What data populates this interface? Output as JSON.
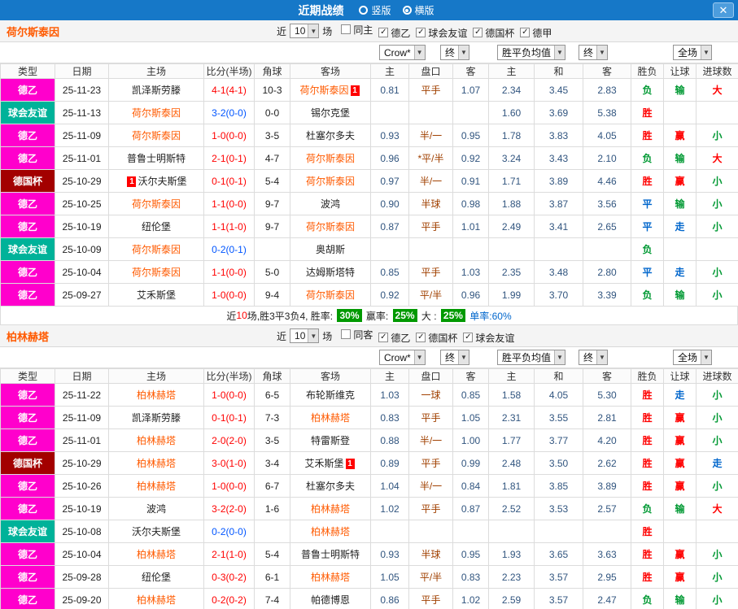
{
  "titlebar": {
    "title": "近期战绩",
    "layout_options": [
      {
        "label": "竖版",
        "selected": false
      },
      {
        "label": "横版",
        "selected": true
      }
    ],
    "close_glyph": "✕"
  },
  "columns": [
    "类型",
    "日期",
    "主场",
    "比分(半场)",
    "角球",
    "客场",
    "主",
    "盘口",
    "客",
    "主",
    "和",
    "客",
    "胜负",
    "让球",
    "进球数"
  ],
  "colors": {
    "titlebar_bg": "#1678c8",
    "team_focus": "#ff5a00",
    "score_red": "#ff0000",
    "score_blue": "#0055ff",
    "rate_badge_bg": "#009900",
    "type_colors": {
      "德乙": "#ff00cc",
      "球会友谊": "#00b299",
      "德国杯": "#a30000"
    },
    "outcome_colors": {
      "胜": "#ff0000",
      "平": "#0066cc",
      "负": "#009933",
      "赢": "#ff0000",
      "走": "#0066cc",
      "输": "#009933",
      "大": "#ff0000",
      "小": "#009933"
    }
  },
  "sections": [
    {
      "team": "荷尔斯泰因",
      "filter": {
        "near_label": "近",
        "count": "10",
        "games_label": "场",
        "checkboxes": [
          {
            "label": "同主",
            "checked": false
          },
          {
            "label": "德乙",
            "checked": true
          },
          {
            "label": "球会友谊",
            "checked": true
          },
          {
            "label": "德国杯",
            "checked": true
          },
          {
            "label": "德甲",
            "checked": true
          }
        ]
      },
      "dropdowns": {
        "company": "Crow*",
        "company_time": "终",
        "europe": "胜平负均值",
        "europe_time": "终",
        "scope": "全场"
      },
      "rows": [
        {
          "type": "德乙",
          "date": "25-11-23",
          "home": "凯泽斯劳滕",
          "score": "4-1(4-1)",
          "corner": "10-3",
          "away": "荷尔斯泰因",
          "ab": "1",
          "o1": "0.81",
          "o2": "平手",
          "o3": "1.07",
          "e1": "2.34",
          "e2": "3.45",
          "e3": "2.83",
          "r1": "负",
          "r2": "输",
          "r3": "大"
        },
        {
          "type": "球会友谊",
          "date": "25-11-13",
          "home": "荷尔斯泰因",
          "score": "3-2(0-0)",
          "score_blue": true,
          "corner": "0-0",
          "away": "锡尔克堡",
          "e1": "1.60",
          "e2": "3.69",
          "e3": "5.38",
          "r1": "胜"
        },
        {
          "type": "德乙",
          "date": "25-11-09",
          "home": "荷尔斯泰因",
          "score": "1-0(0-0)",
          "corner": "3-5",
          "away": "杜塞尔多夫",
          "o1": "0.93",
          "o2": "半/一",
          "o3": "0.95",
          "e1": "1.78",
          "e2": "3.83",
          "e3": "4.05",
          "r1": "胜",
          "r2": "赢",
          "r3": "小"
        },
        {
          "type": "德乙",
          "date": "25-11-01",
          "home": "普鲁士明斯特",
          "score": "2-1(0-1)",
          "corner": "4-7",
          "away": "荷尔斯泰因",
          "o1": "0.96",
          "o2": "*平/半",
          "o3": "0.92",
          "e1": "3.24",
          "e2": "3.43",
          "e3": "2.10",
          "r1": "负",
          "r2": "输",
          "r3": "大"
        },
        {
          "type": "德国杯",
          "date": "25-10-29",
          "home": "沃尔夫斯堡",
          "hb_pre": "1",
          "score": "0-1(0-1)",
          "corner": "5-4",
          "away": "荷尔斯泰因",
          "o1": "0.97",
          "o2": "半/一",
          "o3": "0.91",
          "e1": "1.71",
          "e2": "3.89",
          "e3": "4.46",
          "r1": "胜",
          "r2": "赢",
          "r3": "小"
        },
        {
          "type": "德乙",
          "date": "25-10-25",
          "home": "荷尔斯泰因",
          "score": "1-1(0-0)",
          "corner": "9-7",
          "away": "波鸿",
          "o1": "0.90",
          "o2": "半球",
          "o3": "0.98",
          "e1": "1.88",
          "e2": "3.87",
          "e3": "3.56",
          "r1": "平",
          "r2": "输",
          "r3": "小"
        },
        {
          "type": "德乙",
          "date": "25-10-19",
          "home": "纽伦堡",
          "score": "1-1(1-0)",
          "corner": "9-7",
          "away": "荷尔斯泰因",
          "o1": "0.87",
          "o2": "平手",
          "o3": "1.01",
          "e1": "2.49",
          "e2": "3.41",
          "e3": "2.65",
          "r1": "平",
          "r2": "走",
          "r3": "小"
        },
        {
          "type": "球会友谊",
          "date": "25-10-09",
          "home": "荷尔斯泰因",
          "score": "0-2(0-1)",
          "score_blue": true,
          "corner": "",
          "away": "奥胡斯",
          "r1": "负"
        },
        {
          "type": "德乙",
          "date": "25-10-04",
          "home": "荷尔斯泰因",
          "score": "1-1(0-0)",
          "corner": "5-0",
          "away": "达姆斯塔特",
          "o1": "0.85",
          "o2": "平手",
          "o3": "1.03",
          "e1": "2.35",
          "e2": "3.48",
          "e3": "2.80",
          "r1": "平",
          "r2": "走",
          "r3": "小"
        },
        {
          "type": "德乙",
          "date": "25-09-27",
          "home": "艾禾斯堡",
          "score": "1-0(0-0)",
          "corner": "9-4",
          "away": "荷尔斯泰因",
          "o1": "0.92",
          "o2": "平/半",
          "o3": "0.96",
          "e1": "1.99",
          "e2": "3.70",
          "e3": "3.39",
          "r1": "负",
          "r2": "输",
          "r3": "小"
        }
      ],
      "summary": {
        "parts": [
          {
            "t": "近",
            "c": "black"
          },
          {
            "t": "10",
            "c": "red"
          },
          {
            "t": "场,胜3平3负4, 胜率: ",
            "c": "black"
          },
          {
            "t": "30%",
            "badge": true
          },
          {
            "t": " 赢率: ",
            "c": "black"
          },
          {
            "t": "25%",
            "badge": true
          },
          {
            "t": " 大 : ",
            "c": "black"
          },
          {
            "t": "25%",
            "badge": true
          },
          {
            "t": " 单率:60%",
            "c": "blue"
          }
        ]
      }
    },
    {
      "team": "柏林赫塔",
      "filter": {
        "near_label": "近",
        "count": "10",
        "games_label": "场",
        "checkboxes": [
          {
            "label": "同客",
            "checked": false
          },
          {
            "label": "德乙",
            "checked": true
          },
          {
            "label": "德国杯",
            "checked": true
          },
          {
            "label": "球会友谊",
            "checked": true
          }
        ]
      },
      "dropdowns": {
        "company": "Crow*",
        "company_time": "终",
        "europe": "胜平负均值",
        "europe_time": "终",
        "scope": "全场"
      },
      "rows": [
        {
          "type": "德乙",
          "date": "25-11-22",
          "home": "柏林赫塔",
          "score": "1-0(0-0)",
          "corner": "6-5",
          "away": "布轮斯维克",
          "o1": "1.03",
          "o2": "一球",
          "o3": "0.85",
          "e1": "1.58",
          "e2": "4.05",
          "e3": "5.30",
          "r1": "胜",
          "r2": "走",
          "r3": "小"
        },
        {
          "type": "德乙",
          "date": "25-11-09",
          "home": "凯泽斯劳滕",
          "score": "0-1(0-1)",
          "corner": "7-3",
          "away": "柏林赫塔",
          "o1": "0.83",
          "o2": "平手",
          "o3": "1.05",
          "e1": "2.31",
          "e2": "3.55",
          "e3": "2.81",
          "r1": "胜",
          "r2": "赢",
          "r3": "小"
        },
        {
          "type": "德乙",
          "date": "25-11-01",
          "home": "柏林赫塔",
          "score": "2-0(2-0)",
          "corner": "3-5",
          "away": "特雷斯登",
          "o1": "0.88",
          "o2": "半/一",
          "o3": "1.00",
          "e1": "1.77",
          "e2": "3.77",
          "e3": "4.20",
          "r1": "胜",
          "r2": "赢",
          "r3": "小"
        },
        {
          "type": "德国杯",
          "date": "25-10-29",
          "home": "柏林赫塔",
          "score": "3-0(1-0)",
          "corner": "3-4",
          "away": "艾禾斯堡",
          "ab": "1",
          "o1": "0.89",
          "o2": "平手",
          "o3": "0.99",
          "e1": "2.48",
          "e2": "3.50",
          "e3": "2.62",
          "r1": "胜",
          "r2": "赢",
          "r3": "走"
        },
        {
          "type": "德乙",
          "date": "25-10-26",
          "home": "柏林赫塔",
          "score": "1-0(0-0)",
          "corner": "6-7",
          "away": "杜塞尔多夫",
          "o1": "1.04",
          "o2": "半/一",
          "o3": "0.84",
          "e1": "1.81",
          "e2": "3.85",
          "e3": "3.89",
          "r1": "胜",
          "r2": "赢",
          "r3": "小"
        },
        {
          "type": "德乙",
          "date": "25-10-19",
          "home": "波鸿",
          "score": "3-2(2-0)",
          "corner": "1-6",
          "away": "柏林赫塔",
          "o1": "1.02",
          "o2": "平手",
          "o3": "0.87",
          "e1": "2.52",
          "e2": "3.53",
          "e3": "2.57",
          "r1": "负",
          "r2": "输",
          "r3": "大"
        },
        {
          "type": "球会友谊",
          "date": "25-10-08",
          "home": "沃尔夫斯堡",
          "score": "0-2(0-0)",
          "score_blue": true,
          "corner": "",
          "away": "柏林赫塔",
          "r1": "胜"
        },
        {
          "type": "德乙",
          "date": "25-10-04",
          "home": "柏林赫塔",
          "score": "2-1(1-0)",
          "corner": "5-4",
          "away": "普鲁士明斯特",
          "o1": "0.93",
          "o2": "半球",
          "o3": "0.95",
          "e1": "1.93",
          "e2": "3.65",
          "e3": "3.63",
          "r1": "胜",
          "r2": "赢",
          "r3": "小"
        },
        {
          "type": "德乙",
          "date": "25-09-28",
          "home": "纽伦堡",
          "score": "0-3(0-2)",
          "corner": "6-1",
          "away": "柏林赫塔",
          "o1": "1.05",
          "o2": "平/半",
          "o3": "0.83",
          "e1": "2.23",
          "e2": "3.57",
          "e3": "2.95",
          "r1": "胜",
          "r2": "赢",
          "r3": "小"
        },
        {
          "type": "德乙",
          "date": "25-09-20",
          "home": "柏林赫塔",
          "score": "0-2(0-2)",
          "corner": "7-4",
          "away": "帕德博恩",
          "o1": "0.86",
          "o2": "平手",
          "o3": "1.02",
          "e1": "2.59",
          "e2": "3.57",
          "e3": "2.47",
          "r1": "负",
          "r2": "输",
          "r3": "小"
        }
      ]
    }
  ]
}
